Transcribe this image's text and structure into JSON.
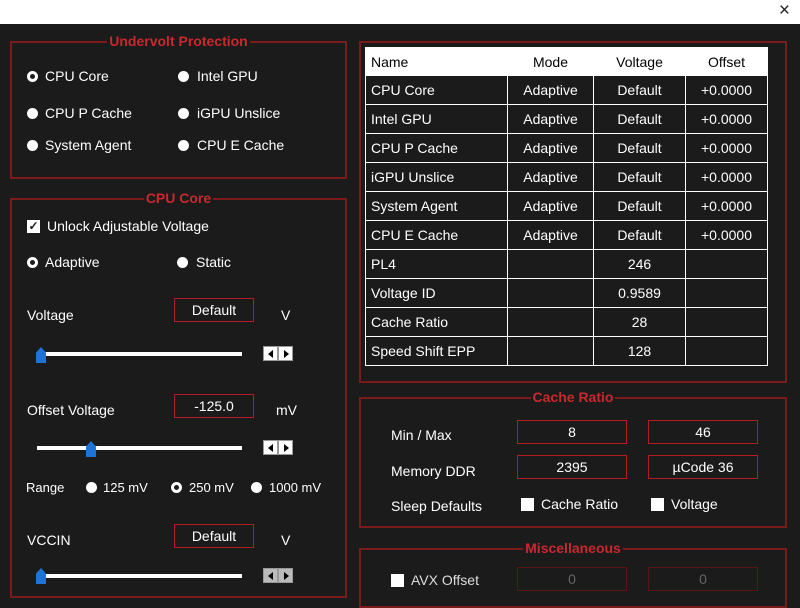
{
  "window": {
    "close_glyph": "×"
  },
  "undervolt": {
    "title": "Undervolt Protection",
    "options": [
      "CPU Core",
      "Intel GPU",
      "CPU P Cache",
      "iGPU Unslice",
      "System Agent",
      "CPU E Cache"
    ],
    "selected": "CPU Core"
  },
  "cpu_core": {
    "title": "CPU Core",
    "unlock_label": "Unlock Adjustable Voltage",
    "unlock_checked": true,
    "mode_adaptive": "Adaptive",
    "mode_static": "Static",
    "mode_selected": "Adaptive",
    "voltage_label": "Voltage",
    "voltage_value": "Default",
    "voltage_unit": "V",
    "offset_label": "Offset Voltage",
    "offset_value": "-125.0",
    "offset_unit": "mV",
    "range_label": "Range",
    "range_options": [
      "125 mV",
      "250 mV",
      "1000 mV"
    ],
    "range_selected": "250 mV",
    "vccin_label": "VCCIN",
    "vccin_value": "Default",
    "vccin_unit": "V"
  },
  "table": {
    "headers": [
      "Name",
      "Mode",
      "Voltage",
      "Offset"
    ],
    "rows": [
      [
        "CPU Core",
        "Adaptive",
        "Default",
        "+0.0000"
      ],
      [
        "Intel GPU",
        "Adaptive",
        "Default",
        "+0.0000"
      ],
      [
        "CPU P Cache",
        "Adaptive",
        "Default",
        "+0.0000"
      ],
      [
        "iGPU Unslice",
        "Adaptive",
        "Default",
        "+0.0000"
      ],
      [
        "System Agent",
        "Adaptive",
        "Default",
        "+0.0000"
      ],
      [
        "CPU E Cache",
        "Adaptive",
        "Default",
        "+0.0000"
      ],
      [
        "PL4",
        "",
        "246",
        ""
      ],
      [
        "Voltage ID",
        "",
        "0.9589",
        ""
      ],
      [
        "Cache Ratio",
        "",
        "28",
        ""
      ],
      [
        "Speed Shift EPP",
        "",
        "128",
        ""
      ]
    ]
  },
  "cache_ratio": {
    "title": "Cache Ratio",
    "minmax_label": "Min / Max",
    "min": "8",
    "max": "46",
    "memory_label": "Memory DDR",
    "memory_value": "2395",
    "ucode_value": "µCode 36",
    "sleep_label": "Sleep Defaults",
    "sleep_cache_label": "Cache Ratio",
    "sleep_voltage_label": "Voltage"
  },
  "misc": {
    "title": "Miscellaneous",
    "avx_label": "AVX Offset",
    "avx_value1": "0",
    "avx_value2": "0"
  },
  "colors": {
    "accent": "#c8282e",
    "border": "#7a1a1a",
    "slider": "#1e74d6",
    "background": "#1b1b1b"
  }
}
